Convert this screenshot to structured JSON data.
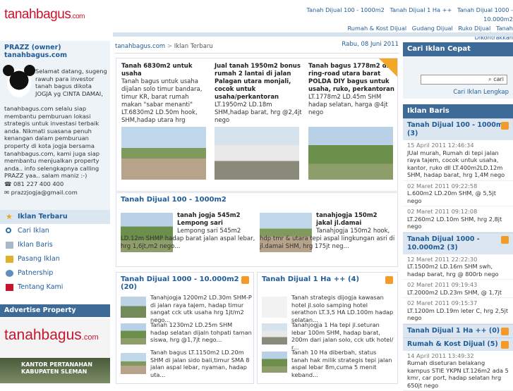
{
  "site": {
    "logo": "tanahbagus",
    "logo_tld": ".com"
  },
  "topnav": [
    "Tanah Dijual 100 - 1000m2",
    "Tanah Dijual 1 Ha ++",
    "Tanah Dijual 1000 - 10.000m2",
    "Rumah & Kost Dijual",
    "Gudang Dijual",
    "Ruko Dijual",
    "Tanah",
    "Dikontrakkan"
  ],
  "owner": {
    "heading": "PRAZZ (owner) tanahbagus.com",
    "welcome": "Selamat datang, sugeng rawuh para investor tanah bagus dikota JOGJA yg CINTA DAMAI,",
    "body": "tanahbagus.com selalu siap membantu pemburuan lokasi strategis untuk investasi terbaik anda. Nikmati suasana penuh kenangan dalam pemburuan property di kota jogja bersama tanahbagus.com, kami juga siap membantu menjualkan property anda.. info selengkapnya calling PRAZZ yaa.. salam maniz :-)",
    "phone": "081 227 400 400",
    "email": "prazzjogja@gmail.com"
  },
  "menu": {
    "heading": "Iklan Terbaru",
    "items": [
      "Cari Iklan",
      "Iklan Baris",
      "Pasang Iklan",
      "Patnership",
      "Tentang Kami"
    ]
  },
  "advertise": {
    "heading": "Advertise Property",
    "banner": "KANTOR PERTANAHAN KABUPATEN SLEMAN"
  },
  "breadcrumb": {
    "home": "tanahbagus.com",
    "sep": ">",
    "current": "Iklan Terbaru"
  },
  "date": "Rabu, 08 Juni 2011",
  "featured": [
    {
      "title": "Tanah 6830m2 untuk usaha",
      "body": "Tanah bagus untuk usaha dijalan solo timur bandara, timur KR, barat rumah makan \"sabar menanti\" LT.6830m2 LD.50m hook, SHM,hadap utara hrg"
    },
    {
      "title": "Jual tanah 1950m2 bonus rumah 2 lantai di jalan Palagan utara monjali, cocok untuk usaha/perkantoran",
      "body": "LT.1950m2 LD.18m SHM,hadap barat, hrg @2,4jt nego"
    },
    {
      "title": "Tanah bagus 1778m2 di ring-road utara barat POLDA DIY bagus untuk usaha, ruko, perkantoran",
      "body": "LT.1778m2 LD.45m SHM hadap selatan, harga @4jt nego"
    }
  ],
  "sec100": {
    "heading": "Tanah Dijual 100 - 1000m2",
    "items": [
      {
        "title": "tanah jogja 545m2 Lempong sari",
        "body": "Lempong sari 545m2 LD.12m SHMP hadap barat jalan aspal lebar, hrg 1,6jt,m2 nego..."
      },
      {
        "title": "tanahjogja 150m2 jakal jl.damai",
        "body": "Tanahjogja 150m2 hook, hdp tmr & utara tepi aspal lingkungan asri di jl.damai SHM, hrg 175jt neg..."
      }
    ]
  },
  "sec1000": {
    "heading": "Tanah Dijual 1000 - 10.000m2 (20)",
    "items": [
      "Tanahjogja 1200m2 LD.30m SHM-P di jalan raya tajem, hadap timur sangat cck utk usaha hrg 1jt/m2 nego...",
      "Tanah 1230m2 LD.25m SHM hadap selatan dijaln tohpati taman siswa, hrg @1,7jt nego...",
      "Tanah bagus LT.1150m2 LD.20m SHM di jalan sido bali,timur SMA 8 jalan aspal lebar, nyaman, hadap uta..."
    ]
  },
  "sec1ha": {
    "heading": "Tanah Dijual 1 Ha ++ (4)",
    "items": [
      "Tanah strategis dijogja kawasan hotel jl.solo samping hotel serathon LT.3,5 HA LD.100m hadap selatan...",
      "Tanahjogja 1 Ha tepi jl.seturan lebar 100m SHM, hadap barat, 200m dari jalan solo, cck utk hotel/ r...",
      "Tanah 10 Ha diberbah, status tanah hak milik strategis tepi jalan aspal lebar 8m,cuma 5 menit keband..."
    ]
  },
  "search": {
    "heading": "Cari Iklan Cepat",
    "button": "cari",
    "link": "Cari Iklan Lengkap"
  },
  "baris": {
    "heading": "Iklan Baris",
    "cats": [
      {
        "name": "Tanah Dijual 100 - 1000m2 (3)",
        "entries": [
          {
            "date": "15 April 2011 12:46:34",
            "text": "JUal murah, Rumah di tepi jalan raya tajem, cocok untuk usaha, kantor, ruko dll LT.400m2LD.12m SHM, hadap barat, hrg 1,4M nego"
          },
          {
            "date": "02 Maret 2011 09:22:58",
            "text": "L.600m2 LD.20m SHM, @ 5,5jt nego"
          },
          {
            "date": "02 Maret 2011 09:12:08",
            "text": "LT.260m2 LD.10m SHM, hrg 2,8jt nego"
          }
        ]
      },
      {
        "name": "Tanah Dijual 1000 - 10.000m2 (3)",
        "entries": [
          {
            "date": "12 Maret 2011 22:22:30",
            "text": "LT.1500m2 LD.16m SHM swh, hadap barat, hrg @ 800rb nego"
          },
          {
            "date": "02 Maret 2011 09:19:43",
            "text": "LT.2000m2 LD.23m SHM, @ 1,7jt"
          },
          {
            "date": "02 Maret 2011 09:15:37",
            "text": "LT.1200m LD.19m leter C, hrg 2,5jt nego"
          }
        ]
      },
      {
        "name": "Tanah Dijual 1 Ha ++ (0)",
        "entries": []
      },
      {
        "name": "Rumah & Kost Dijual (5)",
        "entries": [
          {
            "date": "14 April 2011 13:49:32",
            "text": "Rumah diseturan belakang kampus STIE YKPN LT.126m2 ada 5 kmr, car port, hadap selatan hrg 650jt nego"
          }
        ]
      }
    ]
  }
}
